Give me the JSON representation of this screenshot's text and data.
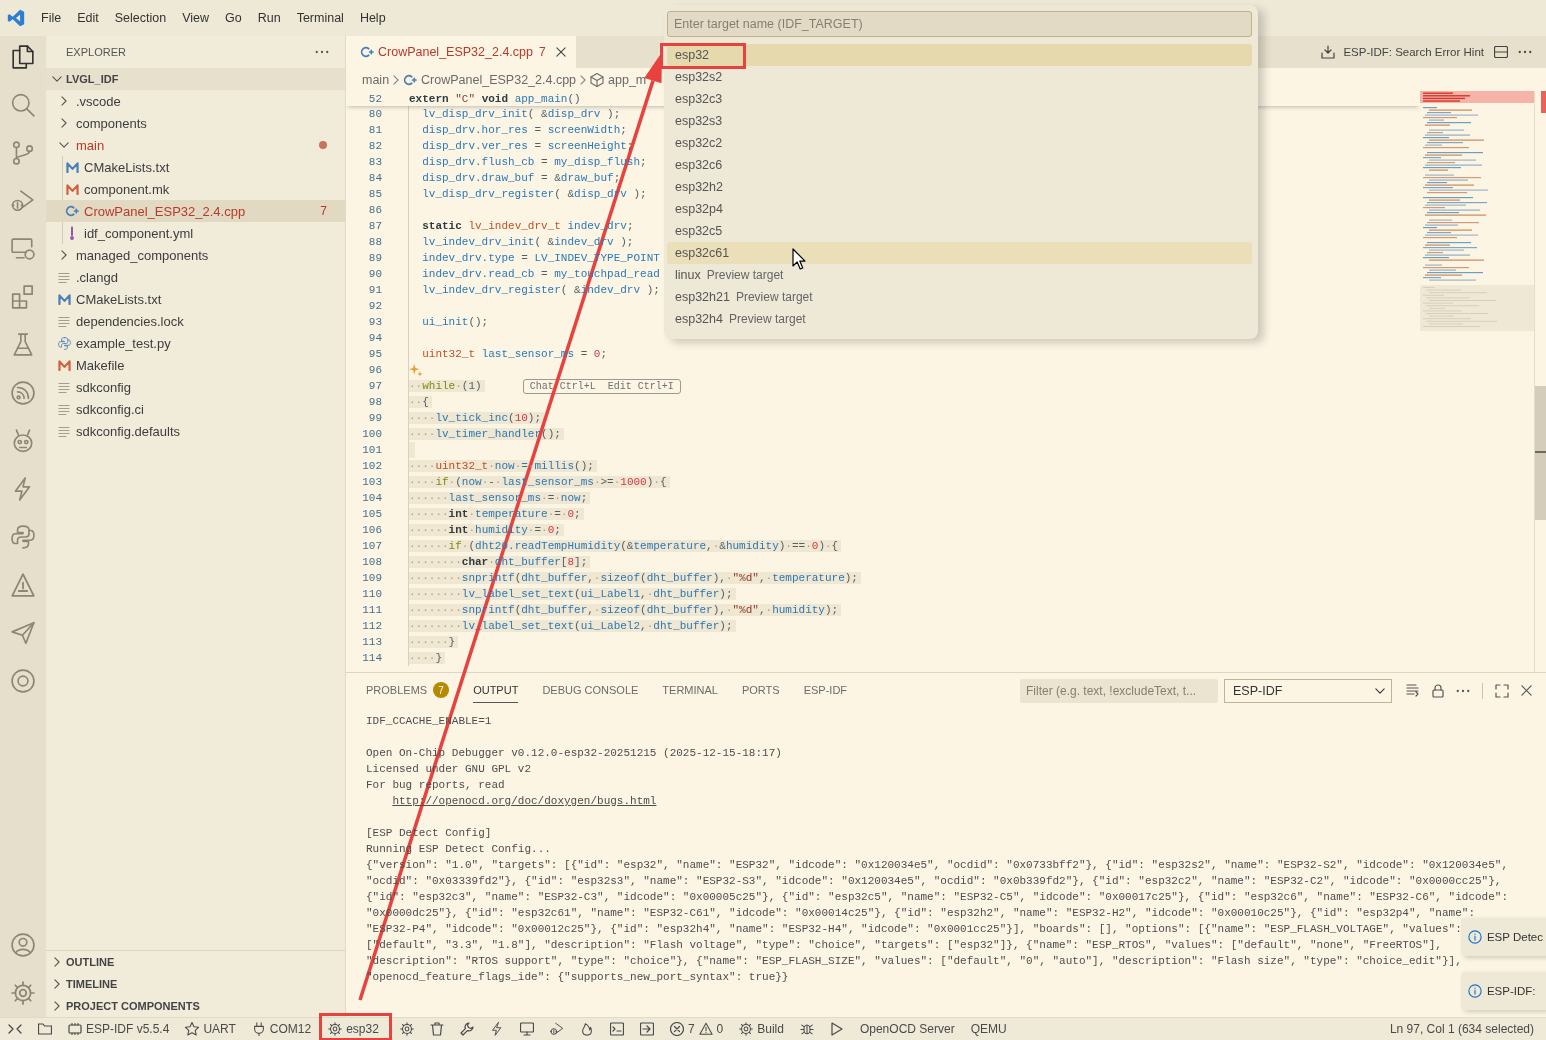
{
  "menu_bar": {
    "items": [
      "File",
      "Edit",
      "Selection",
      "View",
      "Go",
      "Run",
      "Terminal",
      "Help"
    ]
  },
  "activity_bar": {
    "top": [
      {
        "kind": "explorer",
        "selected": true
      },
      {
        "kind": "search",
        "selected": false
      },
      {
        "kind": "source_control",
        "selected": false
      },
      {
        "kind": "run_debug",
        "selected": false
      },
      {
        "kind": "remote",
        "selected": false
      },
      {
        "kind": "extensions",
        "selected": false
      },
      {
        "kind": "testing",
        "selected": false
      },
      {
        "kind": "espressif",
        "selected": false
      },
      {
        "kind": "robot",
        "selected": false
      },
      {
        "kind": "lightning",
        "selected": false
      },
      {
        "kind": "python",
        "selected": false
      },
      {
        "kind": "triangle",
        "selected": false
      },
      {
        "kind": "plane",
        "selected": false
      },
      {
        "kind": "ring",
        "selected": false
      }
    ],
    "bottom": [
      {
        "kind": "account"
      },
      {
        "kind": "settings"
      }
    ]
  },
  "sidebar": {
    "title": "EXPLORER",
    "root": {
      "label": "LVGL_IDF",
      "expanded": true
    },
    "tree": [
      {
        "label": ".vscode",
        "kind": "folder",
        "expanded": false,
        "selected": false,
        "has_errors": false
      },
      {
        "label": "components",
        "kind": "folder",
        "expanded": false,
        "selected": false,
        "has_errors": false
      },
      {
        "label": "main",
        "kind": "folder",
        "expanded": true,
        "selected": false,
        "has_errors": true,
        "children": [
          {
            "label": "CMakeLists.txt",
            "kind": "cmake",
            "selected": false,
            "has_errors": false
          },
          {
            "label": "component.mk",
            "kind": "make",
            "selected": false,
            "has_errors": false
          },
          {
            "label": "CrowPanel_ESP32_2.4.cpp",
            "kind": "cpp",
            "selected": true,
            "has_errors": true,
            "problems": "7"
          },
          {
            "label": "idf_component.yml",
            "kind": "yaml",
            "selected": false,
            "has_errors": false
          }
        ]
      },
      {
        "label": "managed_components",
        "kind": "folder",
        "expanded": false,
        "selected": false,
        "has_errors": false
      },
      {
        "label": ".clangd",
        "kind": "text",
        "selected": false,
        "has_errors": false
      },
      {
        "label": "CMakeLists.txt",
        "kind": "cmake",
        "selected": false,
        "has_errors": false
      },
      {
        "label": "dependencies.lock",
        "kind": "text",
        "selected": false,
        "has_errors": false
      },
      {
        "label": "example_test.py",
        "kind": "python",
        "selected": false,
        "has_errors": false
      },
      {
        "label": "Makefile",
        "kind": "make",
        "selected": false,
        "has_errors": false
      },
      {
        "label": "sdkconfig",
        "kind": "text",
        "selected": false,
        "has_errors": false
      },
      {
        "label": "sdkconfig.ci",
        "kind": "text",
        "selected": false,
        "has_errors": false
      },
      {
        "label": "sdkconfig.defaults",
        "kind": "text",
        "selected": false,
        "has_errors": false
      }
    ],
    "sections": [
      {
        "label": "OUTLINE",
        "expanded": false
      },
      {
        "label": "TIMELINE",
        "expanded": false
      },
      {
        "label": "PROJECT COMPONENTS",
        "expanded": false
      }
    ]
  },
  "editor": {
    "tabs": [
      {
        "label": "CrowPanel_ESP32_2.4.cpp",
        "problems": "7",
        "has_errors": true,
        "selected": true
      }
    ],
    "actions": {
      "label": "ESP-IDF: Search Error Hint"
    },
    "breadcrumb": [
      {
        "kind": "folder",
        "label": "main"
      },
      {
        "kind": "file",
        "label": "CrowPanel_ESP32_2.4.cpp"
      },
      {
        "kind": "symbol",
        "label": "app_m"
      }
    ],
    "sticky_line": {
      "number": "52",
      "tokens": [
        {
          "kind": "keyword",
          "text": "extern "
        },
        {
          "kind": "string",
          "text": "\"C\" "
        },
        {
          "kind": "keyword",
          "text": "void "
        },
        {
          "kind": "ident",
          "text": "app_main"
        },
        {
          "kind": "plain",
          "text": "()"
        }
      ]
    },
    "lines": [
      {
        "number": "80",
        "selected": false,
        "tokens": [
          {
            "kind": "ident",
            "text": "  lv_disp_drv_init"
          },
          {
            "kind": "plain",
            "text": "( &"
          },
          {
            "kind": "ident",
            "text": "disp_drv"
          },
          {
            "kind": "plain",
            "text": " );"
          }
        ]
      },
      {
        "number": "81",
        "selected": false,
        "tokens": [
          {
            "kind": "ident",
            "text": "  disp_drv.hor_res"
          },
          {
            "kind": "plain",
            "text": " = "
          },
          {
            "kind": "ident",
            "text": "screenWidth"
          },
          {
            "kind": "plain",
            "text": ";"
          }
        ]
      },
      {
        "number": "82",
        "selected": false,
        "tokens": [
          {
            "kind": "ident",
            "text": "  disp_drv.ver_res"
          },
          {
            "kind": "plain",
            "text": " = "
          },
          {
            "kind": "ident",
            "text": "screenHeight"
          },
          {
            "kind": "plain",
            "text": ";"
          }
        ]
      },
      {
        "number": "83",
        "selected": false,
        "tokens": [
          {
            "kind": "ident",
            "text": "  disp_drv.flush_cb"
          },
          {
            "kind": "plain",
            "text": " = "
          },
          {
            "kind": "ident",
            "text": "my_disp_flush"
          },
          {
            "kind": "plain",
            "text": ";"
          }
        ]
      },
      {
        "number": "84",
        "selected": false,
        "tokens": [
          {
            "kind": "ident",
            "text": "  disp_drv.draw_buf"
          },
          {
            "kind": "plain",
            "text": " = &"
          },
          {
            "kind": "ident",
            "text": "draw_buf"
          },
          {
            "kind": "plain",
            "text": ";"
          }
        ]
      },
      {
        "number": "85",
        "selected": false,
        "tokens": [
          {
            "kind": "ident",
            "text": "  lv_disp_drv_register"
          },
          {
            "kind": "plain",
            "text": "( &"
          },
          {
            "kind": "ident",
            "text": "disp_drv"
          },
          {
            "kind": "plain",
            "text": " );"
          }
        ]
      },
      {
        "number": "86",
        "selected": false
      },
      {
        "number": "87",
        "selected": false,
        "tokens": [
          {
            "kind": "keyword",
            "text": "  static "
          },
          {
            "kind": "type",
            "text": "lv_indev_drv_t "
          },
          {
            "kind": "ident",
            "text": "indev_drv"
          },
          {
            "kind": "plain",
            "text": ";"
          }
        ]
      },
      {
        "number": "88",
        "selected": false,
        "tokens": [
          {
            "kind": "ident",
            "text": "  lv_indev_drv_init"
          },
          {
            "kind": "plain",
            "text": "( &"
          },
          {
            "kind": "ident",
            "text": "indev_drv"
          },
          {
            "kind": "plain",
            "text": " );"
          }
        ]
      },
      {
        "number": "89",
        "selected": false,
        "tokens": [
          {
            "kind": "ident",
            "text": "  indev_drv.type"
          },
          {
            "kind": "plain",
            "text": " = "
          },
          {
            "kind": "ident",
            "text": "LV_INDEV_TYPE_POINT"
          }
        ]
      },
      {
        "number": "90",
        "selected": false,
        "tokens": [
          {
            "kind": "ident",
            "text": "  indev_drv.read_cb"
          },
          {
            "kind": "plain",
            "text": " = "
          },
          {
            "kind": "ident",
            "text": "my_touchpad_read"
          }
        ]
      },
      {
        "number": "91",
        "selected": false,
        "tokens": [
          {
            "kind": "ident",
            "text": "  lv_indev_drv_register"
          },
          {
            "kind": "plain",
            "text": "( &"
          },
          {
            "kind": "ident",
            "text": "indev_drv"
          },
          {
            "kind": "plain",
            "text": " );"
          }
        ]
      },
      {
        "number": "92",
        "selected": false
      },
      {
        "number": "93",
        "selected": false,
        "tokens": [
          {
            "kind": "ident",
            "text": "  ui_init"
          },
          {
            "kind": "plain",
            "text": "();"
          }
        ]
      },
      {
        "number": "94",
        "selected": false
      },
      {
        "number": "95",
        "selected": false,
        "tokens": [
          {
            "kind": "type",
            "text": "  uint32_t "
          },
          {
            "kind": "ident",
            "text": "last_sensor_ms"
          },
          {
            "kind": "plain",
            "text": " = "
          },
          {
            "kind": "number",
            "text": "0"
          },
          {
            "kind": "plain",
            "text": ";"
          }
        ]
      },
      {
        "number": "96",
        "selected": false,
        "sparkle": true
      },
      {
        "number": "97",
        "selected": true,
        "tokens": [
          {
            "kind": "control",
            "text": "··while"
          },
          {
            "kind": "plain",
            "text": "·(1)"
          }
        ],
        "hint": [
          {
            "label": "Chat",
            "shortcut": "Ctrl+L"
          },
          {
            "label": "Edit",
            "shortcut": "Ctrl+I"
          }
        ]
      },
      {
        "number": "98",
        "selected": true,
        "tokens": [
          {
            "kind": "plain",
            "text": "··{"
          }
        ]
      },
      {
        "number": "99",
        "selected": true,
        "tokens": [
          {
            "kind": "ident",
            "text": "····lv_tick_inc"
          },
          {
            "kind": "plain",
            "text": "("
          },
          {
            "kind": "number",
            "text": "10"
          },
          {
            "kind": "plain",
            "text": ");"
          }
        ]
      },
      {
        "number": "100",
        "selected": true,
        "tokens": [
          {
            "kind": "ident",
            "text": "····lv_timer_handler"
          },
          {
            "kind": "plain",
            "text": "();"
          }
        ]
      },
      {
        "number": "101",
        "selected": true
      },
      {
        "number": "102",
        "selected": true,
        "tokens": [
          {
            "kind": "type",
            "text": "····uint32_t·"
          },
          {
            "kind": "ident",
            "text": "now·=·millis"
          },
          {
            "kind": "plain",
            "text": "();"
          }
        ]
      },
      {
        "number": "103",
        "selected": true,
        "tokens": [
          {
            "kind": "control",
            "text": "····if"
          },
          {
            "kind": "plain",
            "text": "·("
          },
          {
            "kind": "ident",
            "text": "now"
          },
          {
            "kind": "plain",
            "text": "·-·"
          },
          {
            "kind": "ident",
            "text": "last_sensor_ms"
          },
          {
            "kind": "plain",
            "text": "·>=·"
          },
          {
            "kind": "number",
            "text": "1000"
          },
          {
            "kind": "plain",
            "text": ")·{"
          }
        ]
      },
      {
        "number": "104",
        "selected": true,
        "tokens": [
          {
            "kind": "ident",
            "text": "······last_sensor_ms"
          },
          {
            "kind": "plain",
            "text": "·=·"
          },
          {
            "kind": "ident",
            "text": "now"
          },
          {
            "kind": "plain",
            "text": ";"
          }
        ]
      },
      {
        "number": "105",
        "selected": true,
        "tokens": [
          {
            "kind": "keyword",
            "text": "······int·"
          },
          {
            "kind": "ident",
            "text": "temperature"
          },
          {
            "kind": "plain",
            "text": "·=·"
          },
          {
            "kind": "number",
            "text": "0"
          },
          {
            "kind": "plain",
            "text": ";"
          }
        ]
      },
      {
        "number": "106",
        "selected": true,
        "tokens": [
          {
            "kind": "keyword",
            "text": "······int·"
          },
          {
            "kind": "ident",
            "text": "humidity"
          },
          {
            "kind": "plain",
            "text": "·=·"
          },
          {
            "kind": "number",
            "text": "0"
          },
          {
            "kind": "plain",
            "text": ";"
          }
        ]
      },
      {
        "number": "107",
        "selected": true,
        "tokens": [
          {
            "kind": "control",
            "text": "······if"
          },
          {
            "kind": "plain",
            "text": "·("
          },
          {
            "kind": "ident",
            "text": "dht20.readTempHumidity"
          },
          {
            "kind": "plain",
            "text": "(&"
          },
          {
            "kind": "ident",
            "text": "temperature"
          },
          {
            "kind": "plain",
            "text": ",·&"
          },
          {
            "kind": "ident",
            "text": "humidity"
          },
          {
            "kind": "plain",
            "text": ")·==·"
          },
          {
            "kind": "number",
            "text": "0"
          },
          {
            "kind": "plain",
            "text": ")·{"
          }
        ]
      },
      {
        "number": "108",
        "selected": true,
        "tokens": [
          {
            "kind": "keyword",
            "text": "········char·"
          },
          {
            "kind": "ident",
            "text": "dht_buffer"
          },
          {
            "kind": "plain",
            "text": "["
          },
          {
            "kind": "number",
            "text": "8"
          },
          {
            "kind": "plain",
            "text": "];"
          }
        ]
      },
      {
        "number": "109",
        "selected": true,
        "tokens": [
          {
            "kind": "ident",
            "text": "········snprintf"
          },
          {
            "kind": "plain",
            "text": "("
          },
          {
            "kind": "ident",
            "text": "dht_buffer"
          },
          {
            "kind": "plain",
            "text": ",·"
          },
          {
            "kind": "ident",
            "text": "sizeof"
          },
          {
            "kind": "plain",
            "text": "("
          },
          {
            "kind": "ident",
            "text": "dht_buffer"
          },
          {
            "kind": "plain",
            "text": "),·"
          },
          {
            "kind": "string",
            "text": "\"%d\""
          },
          {
            "kind": "plain",
            "text": ",·"
          },
          {
            "kind": "ident",
            "text": "temperature"
          },
          {
            "kind": "plain",
            "text": ");"
          }
        ]
      },
      {
        "number": "110",
        "selected": true,
        "tokens": [
          {
            "kind": "ident",
            "text": "········lv_label_set_text"
          },
          {
            "kind": "plain",
            "text": "("
          },
          {
            "kind": "ident",
            "text": "ui_Label1"
          },
          {
            "kind": "plain",
            "text": ",·"
          },
          {
            "kind": "ident",
            "text": "dht_buffer"
          },
          {
            "kind": "plain",
            "text": ");"
          }
        ]
      },
      {
        "number": "111",
        "selected": true,
        "tokens": [
          {
            "kind": "ident",
            "text": "········snprintf"
          },
          {
            "kind": "plain",
            "text": "("
          },
          {
            "kind": "ident",
            "text": "dht_buffer"
          },
          {
            "kind": "plain",
            "text": ",·"
          },
          {
            "kind": "ident",
            "text": "sizeof"
          },
          {
            "kind": "plain",
            "text": "("
          },
          {
            "kind": "ident",
            "text": "dht_buffer"
          },
          {
            "kind": "plain",
            "text": "),·"
          },
          {
            "kind": "string",
            "text": "\"%d\""
          },
          {
            "kind": "plain",
            "text": ",·"
          },
          {
            "kind": "ident",
            "text": "humidity"
          },
          {
            "kind": "plain",
            "text": ");"
          }
        ]
      },
      {
        "number": "112",
        "selected": true,
        "tokens": [
          {
            "kind": "ident",
            "text": "········lv_label_set_text"
          },
          {
            "kind": "plain",
            "text": "("
          },
          {
            "kind": "ident",
            "text": "ui_Label2"
          },
          {
            "kind": "plain",
            "text": ",·"
          },
          {
            "kind": "ident",
            "text": "dht_buffer"
          },
          {
            "kind": "plain",
            "text": ");"
          }
        ]
      },
      {
        "number": "113",
        "selected": true,
        "tokens": [
          {
            "kind": "plain",
            "text": "······}"
          }
        ]
      },
      {
        "number": "114",
        "selected": true,
        "tokens": [
          {
            "kind": "plain",
            "text": "····}"
          }
        ]
      }
    ]
  },
  "quick_pick": {
    "placeholder": "Enter target name (IDF_TARGET)",
    "items": [
      {
        "label": "esp32",
        "selected": true,
        "hovered": false,
        "annotated": true
      },
      {
        "label": "esp32s2",
        "selected": false,
        "hovered": false
      },
      {
        "label": "esp32c3",
        "selected": false,
        "hovered": false
      },
      {
        "label": "esp32s3",
        "selected": false,
        "hovered": false
      },
      {
        "label": "esp32c2",
        "selected": false,
        "hovered": false
      },
      {
        "label": "esp32c6",
        "selected": false,
        "hovered": false
      },
      {
        "label": "esp32h2",
        "selected": false,
        "hovered": false
      },
      {
        "label": "esp32p4",
        "selected": false,
        "hovered": false
      },
      {
        "label": "esp32c5",
        "selected": false,
        "hovered": false
      },
      {
        "label": "esp32c61",
        "selected": false,
        "hovered": true
      },
      {
        "label": "linux",
        "description": "Preview target",
        "selected": false,
        "hovered": false
      },
      {
        "label": "esp32h21",
        "description": "Preview target",
        "selected": false,
        "hovered": false
      },
      {
        "label": "esp32h4",
        "description": "Preview target",
        "selected": false,
        "hovered": false
      }
    ]
  },
  "panel": {
    "tabs": [
      {
        "label": "PROBLEMS",
        "badge": "7",
        "selected": false
      },
      {
        "label": "OUTPUT",
        "selected": true
      },
      {
        "label": "DEBUG CONSOLE",
        "selected": false
      },
      {
        "label": "TERMINAL",
        "selected": false
      },
      {
        "label": "PORTS",
        "selected": false
      },
      {
        "label": "ESP-IDF",
        "selected": false
      }
    ],
    "filter_placeholder": "Filter (e.g. text, !excludeText, t...",
    "channel": "ESP-IDF",
    "output": [
      [
        {
          "kind": "text",
          "text": "IDF_CCACHE_ENABLE=1"
        }
      ],
      [
        {
          "kind": "text",
          "text": "Open On-Chip Debugger v0.12.0-esp32-20251215 (2025-12-15-18:17)"
        },
        {
          "kind": "text",
          "text": "Licensed under GNU GPL v2"
        },
        {
          "kind": "text",
          "text": "For bug reports, read"
        },
        {
          "kind": "link",
          "text": "http://openocd.org/doc/doxygen/bugs.html"
        }
      ],
      [
        {
          "kind": "text",
          "text": "[ESP Detect Config]"
        },
        {
          "kind": "text",
          "text": "Running ESP Detect Config..."
        },
        {
          "kind": "text",
          "text": "{\"version\": \"1.0\", \"targets\": [{\"id\": \"esp32\", \"name\": \"ESP32\", \"idcode\": \"0x120034e5\", \"ocdid\": \"0x0733bff2\"}, {\"id\": \"esp32s2\", \"name\": \"ESP32-S2\", \"idcode\": \"0x120034e5\","
        },
        {
          "kind": "text",
          "text": "\"ocdid\": \"0x03339fd2\"}, {\"id\": \"esp32s3\", \"name\": \"ESP32-S3\", \"idcode\": \"0x120034e5\", \"ocdid\": \"0x0b339fd2\"}, {\"id\": \"esp32c2\", \"name\": \"ESP32-C2\", \"idcode\": \"0x0000cc25\"},"
        },
        {
          "kind": "text",
          "text": "{\"id\": \"esp32c3\", \"name\": \"ESP32-C3\", \"idcode\": \"0x00005c25\"}, {\"id\": \"esp32c5\", \"name\": \"ESP32-C5\", \"idcode\": \"0x00017c25\"}, {\"id\": \"esp32c6\", \"name\": \"ESP32-C6\", \"idcode\":"
        },
        {
          "kind": "text",
          "text": "\"0x0000dc25\"}, {\"id\": \"esp32c61\", \"name\": \"ESP32-C61\", \"idcode\": \"0x00014c25\"}, {\"id\": \"esp32h2\", \"name\": \"ESP32-H2\", \"idcode\": \"0x00010c25\"}, {\"id\": \"esp32p4\", \"name\":"
        },
        {
          "kind": "text",
          "text": "\"ESP32-P4\", \"idcode\": \"0x00012c25\"}, {\"id\": \"esp32h4\", \"name\": \"ESP32-H4\", \"idcode\": \"0x0001cc25\"}], \"boards\": [], \"options\": [{\"name\": \"ESP_FLASH_VOLTAGE\", \"values\":"
        },
        {
          "kind": "text",
          "text": "[\"default\", \"3.3\", \"1.8\"], \"description\": \"Flash voltage\", \"type\": \"choice\", \"targets\": [\"esp32\"]}, {\"name\": \"ESP_RTOS\", \"values\": [\"default\", \"none\", \"FreeRTOS\"],"
        },
        {
          "kind": "text",
          "text": "\"description\": \"RTOS support\", \"type\": \"choice\"}, {\"name\": \"ESP_FLASH_SIZE\", \"values\": [\"default\", \"0\", \"auto\"], \"description\": \"Flash size\", \"type\": \"choice_edit\"}],"
        },
        {
          "kind": "text",
          "text": "\"openocd_feature_flags_ide\": {\"supports_new_port_syntax\": true}}"
        }
      ]
    ]
  },
  "notifications": [
    {
      "text": "ESP Detec"
    },
    {
      "text": "ESP-IDF:"
    }
  ],
  "status_bar": {
    "items": [
      {
        "kind": "remote"
      },
      {
        "kind": "folder"
      },
      {
        "kind": "chip",
        "text": "ESP-IDF v5.5.4"
      },
      {
        "kind": "star",
        "text": "UART"
      },
      {
        "kind": "plug",
        "text": "COM12"
      },
      {
        "kind": "gear",
        "text": "esp32",
        "annotated": true
      },
      {
        "kind": "gear"
      },
      {
        "kind": "trash"
      },
      {
        "kind": "wrench"
      },
      {
        "kind": "lightning"
      },
      {
        "kind": "monitor"
      },
      {
        "kind": "play_bug"
      },
      {
        "kind": "flame"
      },
      {
        "kind": "terminal"
      },
      {
        "kind": "arrow_box"
      },
      {
        "kind": "problems",
        "errors": "7",
        "warnings": "0"
      },
      {
        "kind": "gear",
        "text": "Build"
      },
      {
        "kind": "bug"
      },
      {
        "kind": "play"
      },
      {
        "kind": "text",
        "text": "OpenOCD Server"
      },
      {
        "kind": "text",
        "text": "QEMU"
      }
    ],
    "cursor_position": "Ln 97, Col 1 (634 selected)"
  }
}
